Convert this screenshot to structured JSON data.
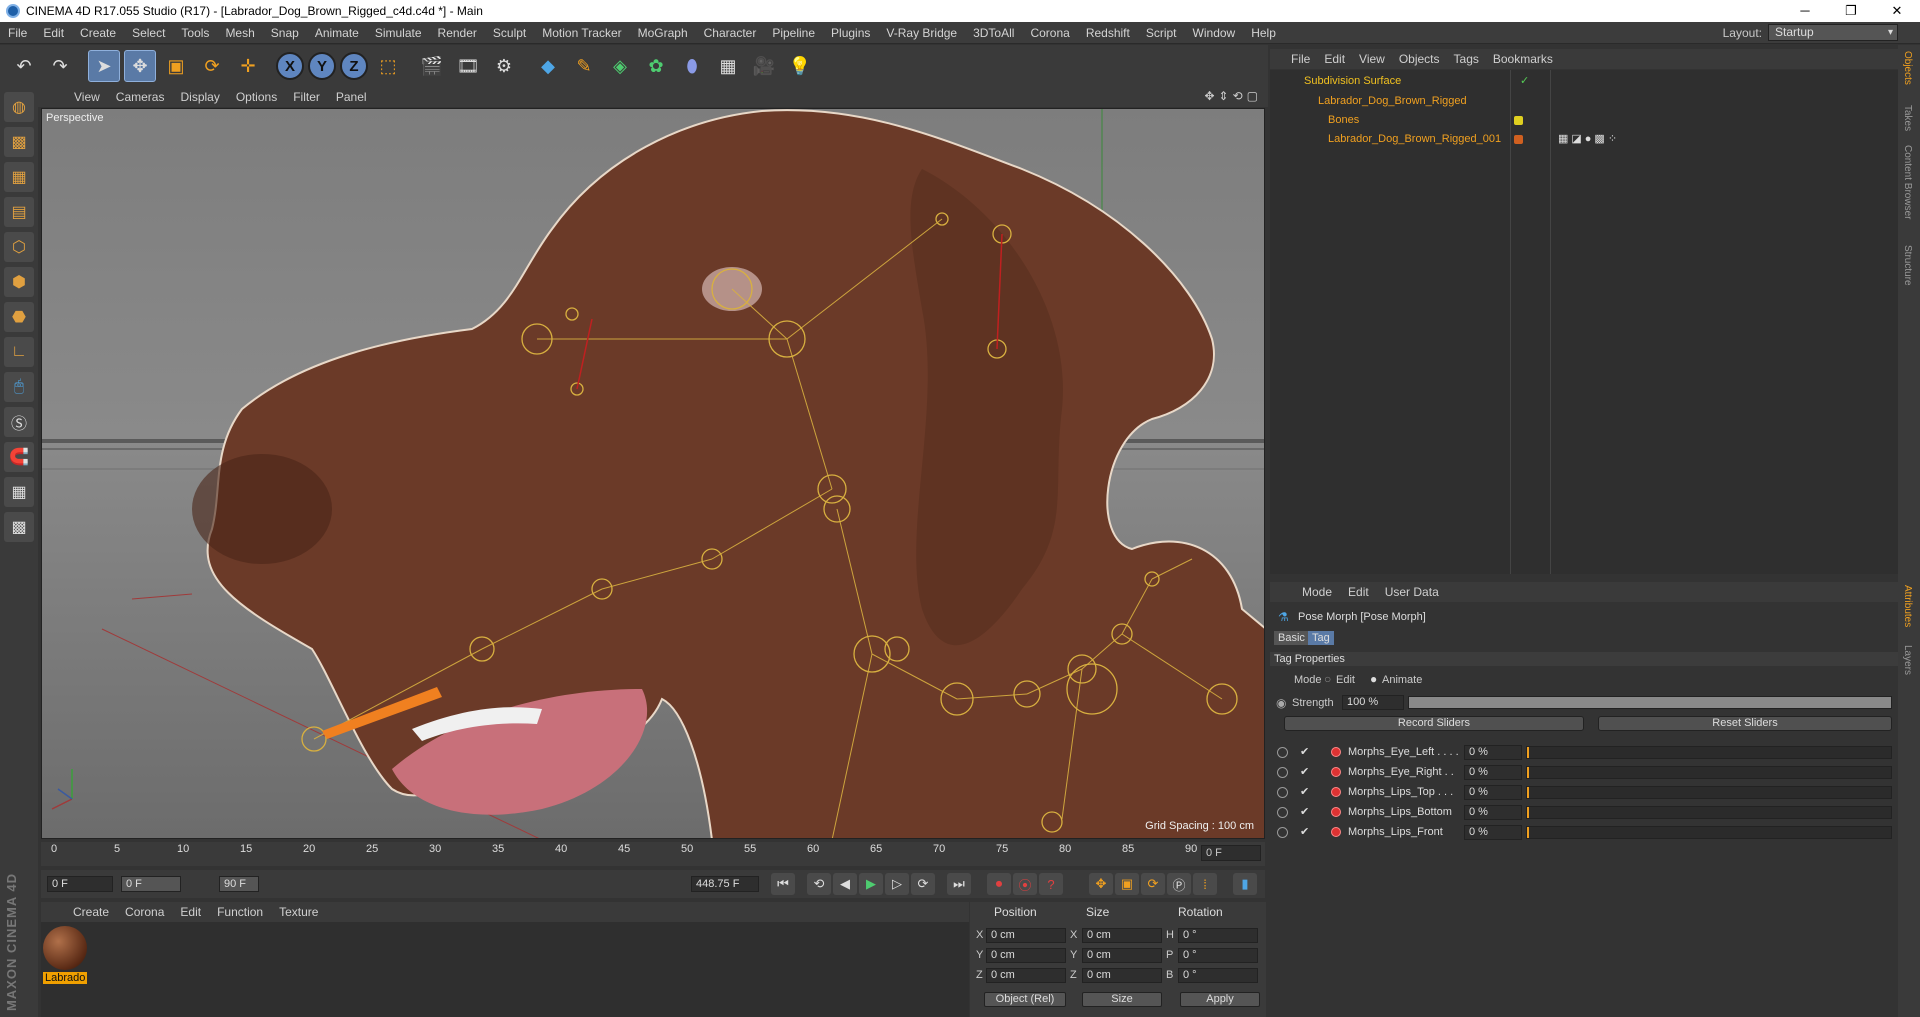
{
  "window": {
    "title": "CINEMA 4D R17.055 Studio (R17) - [Labrador_Dog_Brown_Rigged_c4d.c4d *] - Main"
  },
  "menu": [
    "File",
    "Edit",
    "Create",
    "Select",
    "Tools",
    "Mesh",
    "Snap",
    "Animate",
    "Simulate",
    "Render",
    "Sculpt",
    "Motion Tracker",
    "MoGraph",
    "Character",
    "Pipeline",
    "Plugins",
    "V-Ray Bridge",
    "3DToAll",
    "Corona",
    "Redshift",
    "Script",
    "Window",
    "Help"
  ],
  "layout": {
    "label": "Layout:",
    "value": "Startup"
  },
  "viewport": {
    "menu": [
      "View",
      "Cameras",
      "Display",
      "Options",
      "Filter",
      "Panel"
    ],
    "label": "Perspective",
    "grid_spacing": "Grid Spacing : 100 cm"
  },
  "timeline": {
    "ticks": [
      "0",
      "5",
      "10",
      "15",
      "20",
      "25",
      "30",
      "35",
      "40",
      "45",
      "50",
      "55",
      "60",
      "65",
      "70",
      "75",
      "80",
      "85",
      "90"
    ],
    "current_frame": "0 F",
    "start_field": "0 F",
    "range_start": "0 F",
    "range_end": "90 F",
    "fps_field": "448.75 F"
  },
  "material_manager": {
    "menu": [
      "Create",
      "Corona",
      "Edit",
      "Function",
      "Texture"
    ],
    "material_name": "Labrado"
  },
  "coordinates": {
    "headers": [
      "Position",
      "Size",
      "Rotation"
    ],
    "rows": [
      {
        "a1": "X",
        "pos": "0 cm",
        "a2": "X",
        "size": "0 cm",
        "a3": "H",
        "rot": "0 °"
      },
      {
        "a1": "Y",
        "pos": "0 cm",
        "a2": "Y",
        "size": "0 cm",
        "a3": "P",
        "rot": "0 °"
      },
      {
        "a1": "Z",
        "pos": "0 cm",
        "a2": "Z",
        "size": "0 cm",
        "a3": "B",
        "rot": "0 °"
      }
    ],
    "mode": "Object (Rel)",
    "size_mode": "Size",
    "apply": "Apply"
  },
  "object_manager": {
    "menu": [
      "File",
      "Edit",
      "View",
      "Objects",
      "Tags",
      "Bookmarks"
    ],
    "objects": [
      {
        "name": "Subdivision Surface",
        "color": "#f0c020"
      },
      {
        "name": "Labrador_Dog_Brown_Rigged",
        "color": "#f0a020"
      },
      {
        "name": "Bones",
        "color": "#f0a020"
      },
      {
        "name": "Labrador_Dog_Brown_Rigged_001",
        "color": "#f0a020"
      }
    ]
  },
  "attribute_manager": {
    "menu": [
      "Mode",
      "Edit",
      "User Data"
    ],
    "title": "Pose Morph [Pose Morph]",
    "tabs": [
      "Basic",
      "Tag"
    ],
    "section": "Tag Properties",
    "mode_label": "Mode",
    "mode_edit": "Edit",
    "mode_animate": "Animate",
    "strength_label": "Strength",
    "strength_value": "100 %",
    "record": "Record Sliders",
    "reset": "Reset Sliders",
    "morphs": [
      {
        "name": "Morphs_Eye_Left . . . .",
        "value": "0 %"
      },
      {
        "name": "Morphs_Eye_Right . .",
        "value": "0 %"
      },
      {
        "name": "Morphs_Lips_Top . . .",
        "value": "0 %"
      },
      {
        "name": "Morphs_Lips_Bottom",
        "value": "0 %"
      },
      {
        "name": "Morphs_Lips_Front",
        "value": "0 %"
      }
    ]
  },
  "right_tabs": [
    "Objects",
    "Takes",
    "Content Browser",
    "Structure",
    "Attributes",
    "Layers"
  ],
  "brand": "MAXON CINEMA 4D",
  "accent": "#f0a020",
  "selection_blue": "#5a7aa6"
}
